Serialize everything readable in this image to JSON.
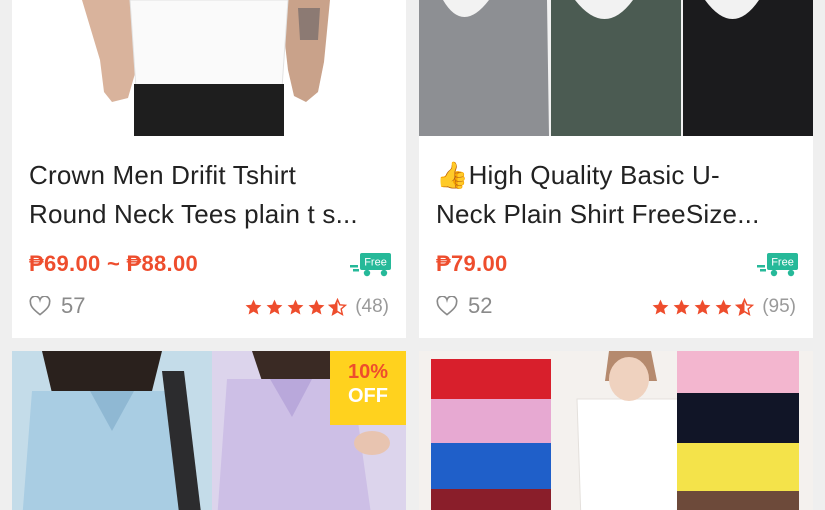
{
  "colors": {
    "accent": "#ee4d2d",
    "free_shipping": "#26b999",
    "discount_bg": "#ffd21e"
  },
  "products": [
    {
      "title_line1": "Crown Men Drifit Tshirt",
      "title_line2": "Round Neck Tees plain t s...",
      "price": "₱69.00 ~ ₱88.00",
      "free_label": "Free",
      "likes": "57",
      "rating": 4.5,
      "review_count": "(48)"
    },
    {
      "title_emoji": "👍",
      "title_line1": "High Quality Basic U-",
      "title_line2": "Neck Plain Shirt FreeSize...",
      "price": "₱79.00",
      "free_label": "Free",
      "likes": "52",
      "rating": 4.5,
      "review_count": "(95)"
    },
    {
      "discount_pct": "10%",
      "discount_off": "OFF"
    },
    {}
  ]
}
